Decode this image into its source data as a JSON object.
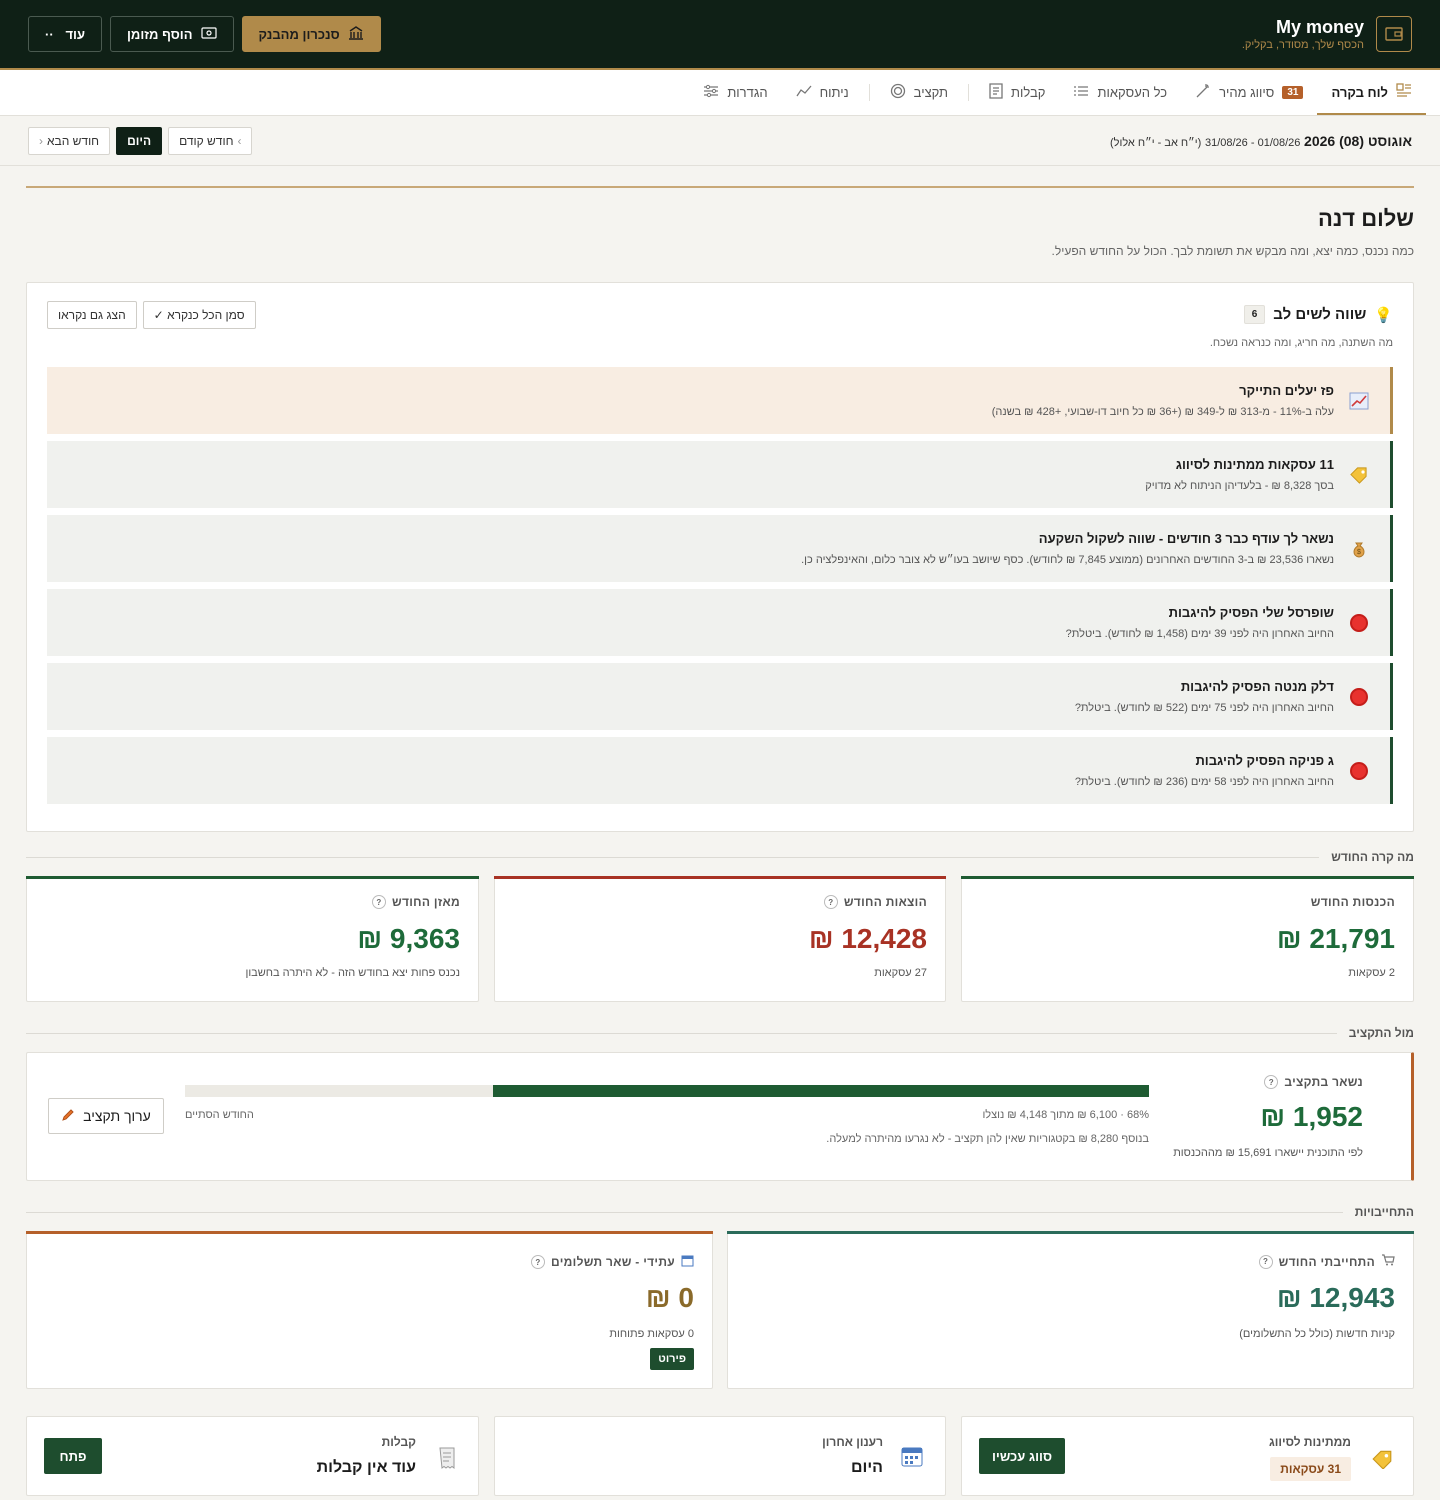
{
  "app": {
    "title": "My money",
    "subtitle": "הכסף שלך, מסודר, בקליק."
  },
  "top_actions": {
    "sync_bank": "סנכרון מהבנק",
    "add_cash": "הוסף מזומן",
    "more": "עוד"
  },
  "tabs": [
    {
      "label": "לוח בקרה",
      "icon": "dashboard-icon",
      "active": true
    },
    {
      "label": "סיווג מהיר",
      "icon": "wand-icon",
      "badge": "31"
    },
    {
      "label": "כל העסקאות",
      "icon": "list-icon"
    },
    {
      "label": "קבלות",
      "icon": "receipt-icon"
    },
    {
      "label": "תקציב",
      "icon": "target-icon"
    },
    {
      "label": "ניתוח",
      "icon": "chart-line-icon"
    },
    {
      "label": "הגדרות",
      "icon": "sliders-icon"
    }
  ],
  "month": {
    "title": "אוגוסט (08) 2026",
    "range": "01/08/26 - 31/08/26",
    "hebrew": "(י״ח אב - י״ח אלול)",
    "prev": "חודש קודם",
    "today": "היום",
    "next": "חודש הבא"
  },
  "greeting": {
    "title": "שלום דנה",
    "subtitle": "כמה נכנס, כמה יצא, ומה מבקש את תשומת לבך. הכול על החודש הפעיל."
  },
  "insights": {
    "title": "שווה לשים לב",
    "count": "6",
    "subtitle": "מה השתנה, מה חריג, ומה כנראה נשכח.",
    "mark_all": "✓ סמן הכל כנקרא",
    "show_read": "הצג גם נקראו",
    "items": [
      {
        "title": "פז יעלים התייקר",
        "desc": "עלה ב-11% - מ-313 ₪ ל-349 ₪ (+36 ₪ כל חיוב דו-שבועי, +428 ₪ בשנה)",
        "icon": "chart-up-icon"
      },
      {
        "title": "11 עסקאות ממתינות לסיווג",
        "desc": "בסך 8,328 ₪ - בלעדיהן הניתוח לא מדויק",
        "icon": "tag-icon"
      },
      {
        "title": "נשאר לך עודף כבר 3 חודשים - שווה לשקול השקעה",
        "desc": "נשארו 23,536 ₪ ב-3 החודשים האחרונים (ממוצע 7,845 ₪ לחודש). כסף שיושב בעו״ש לא צובר כלום, והאינפלציה כן.",
        "icon": "money-bag-icon"
      },
      {
        "title": "שופרסל שלי הפסיק להיגבות",
        "desc": "החיוב האחרון היה לפני 39 ימים (1,458 ₪ לחודש). ביטלת?",
        "icon": "stop-icon"
      },
      {
        "title": "דלק מנטה הפסיק להיגבות",
        "desc": "החיוב האחרון היה לפני 75 ימים (522 ₪ לחודש). ביטלת?",
        "icon": "stop-icon"
      },
      {
        "title": "ג פניקה הפסיק להיגבות",
        "desc": "החיוב האחרון היה לפני 58 ימים (236 ₪ לחודש). ביטלת?",
        "icon": "stop-icon"
      }
    ]
  },
  "month_section": {
    "title": "מה קרה החודש",
    "income": {
      "label": "הכנסות החודש",
      "value": "21,791 ₪",
      "sub": "2 עסקאות",
      "color": "#1e6b3a"
    },
    "expenses": {
      "label": "הוצאות החודש",
      "value": "12,428 ₪",
      "sub": "27 עסקאות",
      "color": "#a83224"
    },
    "balance": {
      "label": "מאזן החודש",
      "value": "9,363 ₪",
      "sub": "נכנס פחות יצא בחודש הזה - לא היתרה בחשבון",
      "color": "#1e6b3a"
    }
  },
  "budget": {
    "title": "מול התקציב",
    "remaining_label": "נשאר בתקציב",
    "remaining_value": "1,952 ₪",
    "remaining_sub": "לפי התוכנית יישארו 15,691 ₪ מההכנסות",
    "progress": 0.68,
    "used_text": "68% · 6,100 ₪ מתוך 4,148 ₪ נוצלו",
    "month_end": "החודש הסתיים",
    "extra_note": "בנוסף 8,280 ₪ בקטגוריות שאין להן תקציב - לא נגרעו מהיתרה למעלה.",
    "edit": "ערוך תקציב"
  },
  "commitments": {
    "title": "התחייבויות",
    "monthly": {
      "label": "התחייבתי החודש",
      "value": "12,943 ₪",
      "sub": "קניות חדשות (כולל כל התשלומים)",
      "color": "#2a6b5a"
    },
    "future": {
      "label": "עתידי - שאר תשלומים",
      "value": "0 ₪",
      "sub": "0 עסקאות פתוחות",
      "button": "פירוט",
      "color": "#8a6a2a"
    }
  },
  "bottom": {
    "pending": {
      "label": "ממתינות לסיווג",
      "badge": "31 עסקאות",
      "button": "סווג עכשיו"
    },
    "refresh": {
      "label": "רענון אחרון",
      "value": "היום"
    },
    "receipts": {
      "label": "קבלות",
      "value": "עוד אין קבלות",
      "button": "פתח"
    }
  },
  "colors": {
    "dark": "#0f2016",
    "gold": "#b08a4a",
    "green": "#1e5b32",
    "red": "#a83224",
    "orange": "#b5602a"
  }
}
